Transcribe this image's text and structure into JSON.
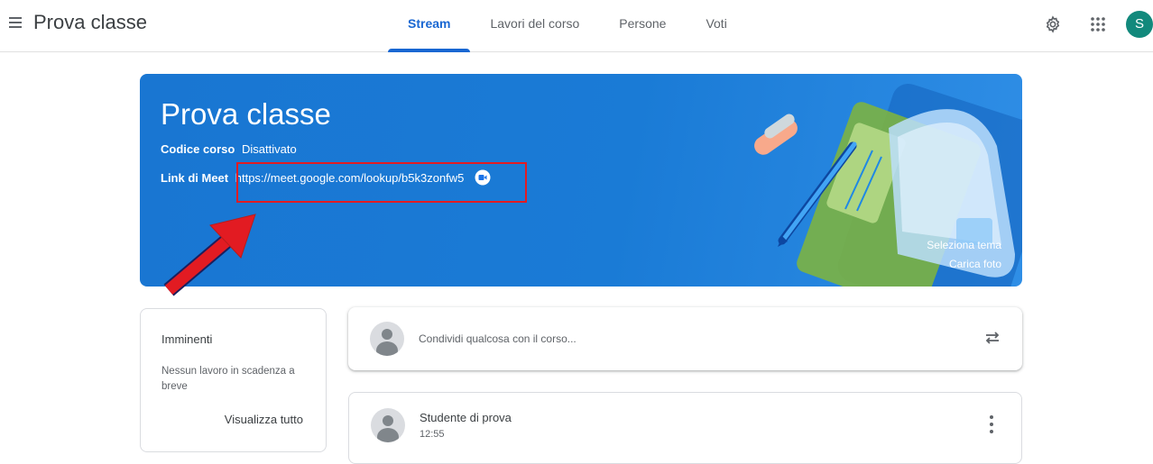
{
  "header": {
    "app_title": "Prova classe",
    "tabs": [
      {
        "label": "Stream",
        "active": true
      },
      {
        "label": "Lavori del corso",
        "active": false
      },
      {
        "label": "Persone",
        "active": false
      },
      {
        "label": "Voti",
        "active": false
      }
    ],
    "avatar_initial": "S",
    "icons": [
      "menu-icon",
      "gear-icon",
      "apps-grid-icon"
    ]
  },
  "banner": {
    "title": "Prova classe",
    "course_code_label": "Codice corso",
    "course_code_value": "Disattivato",
    "meet_label": "Link di Meet",
    "meet_url": "https://meet.google.com/lookup/b5k3zonfw5",
    "select_theme": "Seleziona tema",
    "upload_photo": "Carica foto"
  },
  "upcoming": {
    "title": "Imminenti",
    "empty_text": "Nessun lavoro in scadenza a breve",
    "view_all": "Visualizza tutto"
  },
  "share": {
    "placeholder": "Condividi qualcosa con il corso..."
  },
  "post": {
    "author": "Studente di prova",
    "time": "12:55"
  },
  "colors": {
    "accent": "#1967d2",
    "banner": "#1a73e8",
    "avatar": "#12897c",
    "annotation": "#e21b22"
  }
}
